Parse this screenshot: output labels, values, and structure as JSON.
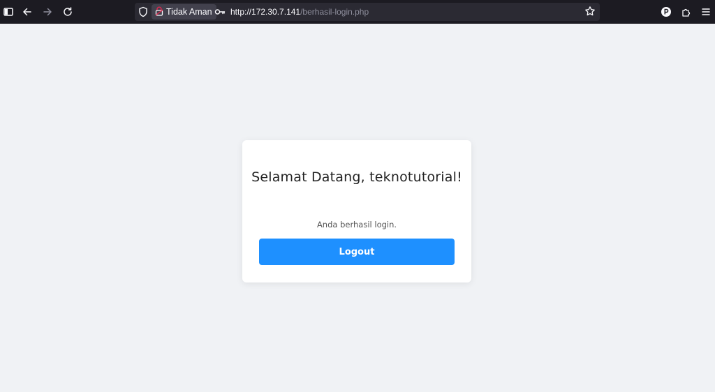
{
  "browser": {
    "security_label": "Tidak Aman",
    "url_host": "http://172.30.7.141",
    "url_path": "/berhasil-login.php"
  },
  "page": {
    "heading": "Selamat Datang, teknotutorial!",
    "message": "Anda berhasil login.",
    "logout_label": "Logout"
  },
  "colors": {
    "toolbar_bg": "#1c1b22",
    "page_bg": "#f0f2f5",
    "button_bg": "#1e90ff",
    "insecure_lock": "#e22850"
  }
}
